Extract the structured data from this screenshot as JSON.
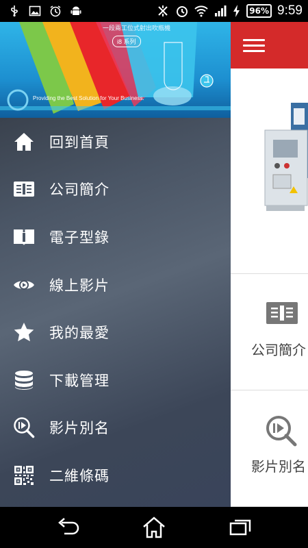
{
  "status_bar": {
    "time": "9:59",
    "battery": "96%",
    "icons": [
      "usb-icon",
      "image-icon",
      "alarm-icon",
      "android-icon",
      "mute-icon",
      "alarm-clock-icon",
      "wifi-icon",
      "signal-icon",
      "charging-icon"
    ]
  },
  "banner": {
    "headline": "一段兩工位式射出吹瓶機",
    "series": "i8 系列",
    "tagline": "Providing the Best Solution for Your Business."
  },
  "drawer_menu": [
    {
      "label": "回到首頁",
      "icon": "home-icon"
    },
    {
      "label": "公司簡介",
      "icon": "company-info-icon"
    },
    {
      "label": "電子型錄",
      "icon": "catalog-book-icon"
    },
    {
      "label": "線上影片",
      "icon": "eye-video-icon"
    },
    {
      "label": "我的最愛",
      "icon": "star-icon"
    },
    {
      "label": "下載管理",
      "icon": "database-icon"
    },
    {
      "label": "影片別名",
      "icon": "video-search-icon"
    },
    {
      "label": "二維條碼",
      "icon": "qr-code-icon"
    }
  ],
  "content": {
    "cards": [
      {
        "label": "公司簡介",
        "icon": "company-info-icon"
      },
      {
        "label": "影片別名",
        "icon": "video-search-icon"
      }
    ]
  },
  "colors": {
    "accent_red": "#d42a2a",
    "banner_blue": "#1d8fd0",
    "drawer_bg": "#4a5565"
  }
}
